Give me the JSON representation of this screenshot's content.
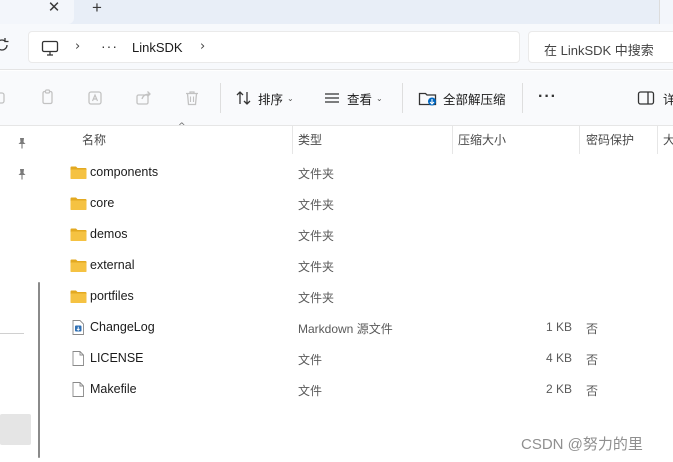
{
  "window": {
    "tab_close_glyph": "✕",
    "tab_new_glyph": "+"
  },
  "address_bar": {
    "computer_icon": "monitor-icon",
    "separator_glyph": "›",
    "overflow_glyph": "···",
    "current_folder": "LinkSDK",
    "search_placeholder": "在 LinkSDK 中搜索"
  },
  "toolbar": {
    "sort_label": "排序",
    "view_label": "查看",
    "extract_all_label": "全部解压缩",
    "more_glyph": "···",
    "details_label": "详",
    "chevron_glyph": "⌄"
  },
  "columns": {
    "name": "名称",
    "type": "类型",
    "compressed_size": "压缩大小",
    "password_protected": "密码保护",
    "next": "大"
  },
  "files": [
    {
      "name": "components",
      "type": "文件夹",
      "size": "",
      "protected": "",
      "icon": "folder-icon"
    },
    {
      "name": "core",
      "type": "文件夹",
      "size": "",
      "protected": "",
      "icon": "folder-icon"
    },
    {
      "name": "demos",
      "type": "文件夹",
      "size": "",
      "protected": "",
      "icon": "folder-icon"
    },
    {
      "name": "external",
      "type": "文件夹",
      "size": "",
      "protected": "",
      "icon": "folder-icon"
    },
    {
      "name": "portfiles",
      "type": "文件夹",
      "size": "",
      "protected": "",
      "icon": "folder-icon"
    },
    {
      "name": "ChangeLog",
      "type": "Markdown 源文件",
      "size": "1 KB",
      "protected": "否",
      "icon": "markdown-file-icon"
    },
    {
      "name": "LICENSE",
      "type": "文件",
      "size": "4 KB",
      "protected": "否",
      "icon": "file-icon"
    },
    {
      "name": "Makefile",
      "type": "文件",
      "size": "2 KB",
      "protected": "否",
      "icon": "file-icon"
    }
  ],
  "colors": {
    "folder": "#f5c242",
    "folder_dark": "#e3a921",
    "toolbar_bg": "#f9fafc",
    "tab_bar_bg": "#e8eef7",
    "accent": "#0067c0"
  },
  "watermark": "CSDN @努力的里"
}
